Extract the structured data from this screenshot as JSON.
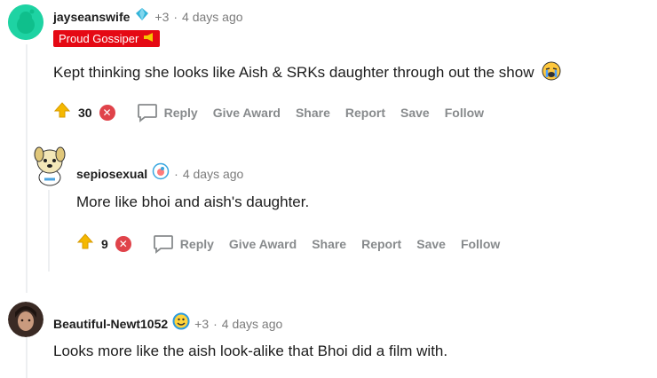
{
  "comments": [
    {
      "author": "jayseanswife",
      "extra_awards": "+3",
      "time": "4 days ago",
      "flair": "Proud Gossiper",
      "text": "Kept thinking she looks like Aish & SRKs daughter through out the show",
      "score": "30",
      "actions": {
        "reply": "Reply",
        "give_award": "Give Award",
        "share": "Share",
        "report": "Report",
        "save": "Save",
        "follow": "Follow"
      }
    },
    {
      "author": "sepiosexual",
      "time": "4 days ago",
      "text": "More like bhoi and aish's daughter.",
      "score": "9",
      "actions": {
        "reply": "Reply",
        "give_award": "Give Award",
        "share": "Share",
        "report": "Report",
        "save": "Save",
        "follow": "Follow"
      }
    },
    {
      "author": "Beautiful-Newt1052",
      "extra_awards": "+3",
      "time": "4 days ago",
      "text": "Looks more like the aish look-alike that Bhoi did a film with."
    }
  ],
  "separator": "·",
  "colors": {
    "flair_bg": "#e50914",
    "downvote": "#e0434a",
    "action_text": "#878a8c"
  }
}
